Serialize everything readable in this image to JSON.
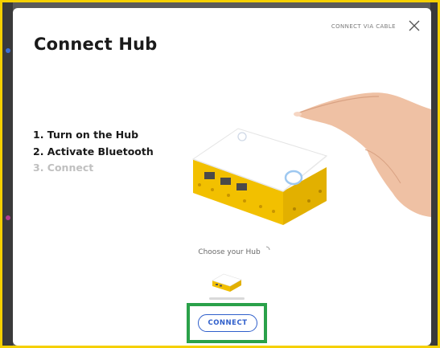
{
  "modal": {
    "title": "Connect Hub",
    "cable_link_label": "CONNECT VIA CABLE",
    "close_icon": "close-icon"
  },
  "steps": [
    {
      "label": "1. Turn on the Hub",
      "state": "active"
    },
    {
      "label": "2. Activate Bluetooth",
      "state": "active"
    },
    {
      "label": "3. Connect",
      "state": "inactive"
    }
  ],
  "hub_picker": {
    "prompt": "Choose your Hub",
    "loading_icon": "spinner-icon",
    "hub_icon": "hub-thumbnail-icon"
  },
  "actions": {
    "connect_label": "CONNECT"
  },
  "colors": {
    "accent_blue": "#2f5fcb",
    "hub_yellow": "#f5c400",
    "highlight_green": "#2aa14a",
    "frame_yellow": "#f5d000",
    "step_inactive": "#c0c0c0"
  }
}
